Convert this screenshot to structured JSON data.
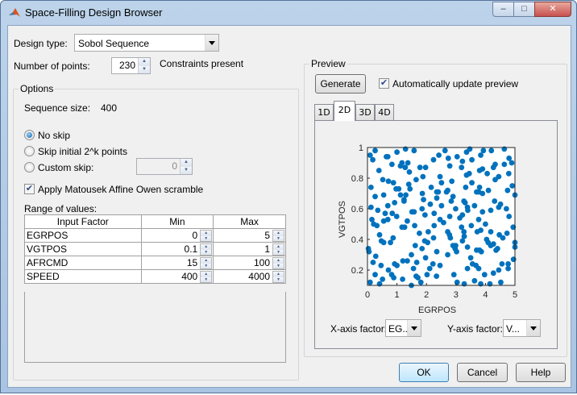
{
  "window": {
    "title": "Space-Filling Design Browser",
    "minimize": "–",
    "maximize": "□",
    "close": "✕"
  },
  "design_type": {
    "label": "Design type:",
    "value": "Sobol Sequence"
  },
  "num_points": {
    "label": "Number of points:",
    "value": "230",
    "note": "Constraints present"
  },
  "options": {
    "title": "Options",
    "sequence_size_label": "Sequence size:",
    "sequence_size": "400",
    "skip": [
      {
        "label": "No skip",
        "selected": true
      },
      {
        "label": "Skip initial 2^k points",
        "selected": false
      },
      {
        "label": "Custom skip:",
        "selected": false
      }
    ],
    "custom_skip_value": "0",
    "scramble": {
      "label": "Apply Matousek Affine Owen scramble",
      "checked": true
    },
    "range_label": "Range of values:",
    "table": {
      "headers": [
        "Input Factor",
        "Min",
        "Max"
      ],
      "rows": [
        [
          "EGRPOS",
          "0",
          "5"
        ],
        [
          "VGTPOS",
          "0.1",
          "1"
        ],
        [
          "AFRCMD",
          "15",
          "100"
        ],
        [
          "SPEED",
          "400",
          "4000"
        ]
      ]
    }
  },
  "preview": {
    "title": "Preview",
    "generate": "Generate",
    "auto_update": {
      "label": "Automatically update preview",
      "checked": true
    },
    "tabs": [
      "1D",
      "2D",
      "3D",
      "4D"
    ],
    "active_tab": "2D",
    "x_factor_label": "X-axis factor:",
    "x_factor_value": "EG...",
    "y_factor_label": "Y-axis factor:",
    "y_factor_value": "V..."
  },
  "buttons": {
    "ok": "OK",
    "cancel": "Cancel",
    "help": "Help"
  },
  "chart_data": {
    "type": "scatter",
    "xlabel": "EGRPOS",
    "ylabel": "VGTPOS",
    "xlim": [
      0,
      5
    ],
    "ylim": [
      0.1,
      1
    ],
    "xticks": [
      "0",
      "1",
      "2",
      "3",
      "4",
      "5"
    ],
    "yticks": [
      "0.2",
      "0.4",
      "0.6",
      "0.8",
      "1"
    ],
    "color": "#0072bd",
    "points": [
      [
        0.09,
        0.95
      ],
      [
        0.26,
        0.98
      ],
      [
        0.18,
        0.92
      ],
      [
        0.69,
        0.94
      ],
      [
        0.64,
        0.94
      ],
      [
        1.0,
        0.97
      ],
      [
        1.29,
        0.99
      ],
      [
        1.58,
        0.98
      ],
      [
        0.83,
        0.89
      ],
      [
        1.17,
        0.9
      ],
      [
        1.12,
        0.88
      ],
      [
        1.37,
        0.9
      ],
      [
        1.28,
        0.87
      ],
      [
        1.78,
        0.87
      ],
      [
        1.97,
        0.87
      ],
      [
        2.24,
        0.92
      ],
      [
        2.42,
        0.95
      ],
      [
        2.63,
        0.98
      ],
      [
        2.74,
        0.93
      ],
      [
        3.04,
        0.94
      ],
      [
        3.22,
        0.91
      ],
      [
        3.19,
        0.87
      ],
      [
        3.36,
        0.97
      ],
      [
        3.47,
        0.99
      ],
      [
        3.54,
        0.92
      ],
      [
        3.84,
        0.95
      ],
      [
        3.93,
        0.98
      ],
      [
        4.2,
        0.98
      ],
      [
        4.33,
        0.89
      ],
      [
        4.27,
        0.87
      ],
      [
        4.64,
        0.99
      ],
      [
        4.8,
        0.93
      ],
      [
        4.89,
        0.9
      ],
      [
        4.64,
        0.89
      ],
      [
        3.8,
        0.85
      ],
      [
        3.9,
        0.86
      ],
      [
        0.39,
        0.85
      ],
      [
        0.52,
        0.79
      ],
      [
        0.71,
        0.78
      ],
      [
        0.88,
        0.77
      ],
      [
        0.97,
        0.73
      ],
      [
        1.06,
        0.73
      ],
      [
        1.12,
        0.69
      ],
      [
        0.12,
        0.74
      ],
      [
        1.42,
        0.84
      ],
      [
        1.4,
        0.76
      ],
      [
        1.44,
        0.73
      ],
      [
        1.65,
        0.79
      ],
      [
        1.88,
        0.81
      ],
      [
        2.16,
        0.74
      ],
      [
        2.35,
        0.71
      ],
      [
        2.46,
        0.81
      ],
      [
        2.51,
        0.77
      ],
      [
        2.72,
        0.72
      ],
      [
        2.86,
        0.78
      ],
      [
        3.33,
        0.74
      ],
      [
        3.36,
        0.82
      ],
      [
        3.45,
        0.83
      ],
      [
        3.54,
        0.77
      ],
      [
        3.8,
        0.74
      ],
      [
        3.7,
        0.71
      ],
      [
        4.06,
        0.83
      ],
      [
        4.1,
        0.72
      ],
      [
        4.33,
        0.79
      ],
      [
        4.45,
        0.81
      ],
      [
        4.79,
        0.83
      ],
      [
        4.91,
        0.75
      ],
      [
        4.75,
        0.72
      ],
      [
        2.79,
        0.88
      ],
      [
        0.26,
        0.68
      ],
      [
        0.55,
        0.69
      ],
      [
        0.92,
        0.64
      ],
      [
        0.69,
        0.62
      ],
      [
        0.12,
        0.61
      ],
      [
        0.35,
        0.59
      ],
      [
        0.6,
        0.57
      ],
      [
        0.84,
        0.57
      ],
      [
        0.99,
        0.55
      ],
      [
        0.15,
        0.53
      ],
      [
        1.24,
        0.66
      ],
      [
        1.3,
        0.69
      ],
      [
        1.24,
        0.65
      ],
      [
        1.51,
        0.58
      ],
      [
        1.58,
        0.58
      ],
      [
        1.86,
        0.7
      ],
      [
        1.9,
        0.66
      ],
      [
        1.85,
        0.6
      ],
      [
        1.95,
        0.56
      ],
      [
        2.13,
        0.63
      ],
      [
        2.26,
        0.57
      ],
      [
        2.4,
        0.71
      ],
      [
        2.35,
        0.67
      ],
      [
        2.51,
        0.62
      ],
      [
        2.68,
        0.71
      ],
      [
        2.9,
        0.68
      ],
      [
        2.84,
        0.65
      ],
      [
        2.99,
        0.6
      ],
      [
        2.79,
        0.55
      ],
      [
        3.27,
        0.65
      ],
      [
        3.31,
        0.64
      ],
      [
        3.39,
        0.61
      ],
      [
        3.4,
        0.59
      ],
      [
        3.63,
        0.62
      ],
      [
        3.77,
        0.71
      ],
      [
        3.9,
        0.7
      ],
      [
        3.9,
        0.58
      ],
      [
        3.77,
        0.53
      ],
      [
        4.18,
        0.59
      ],
      [
        4.31,
        0.65
      ],
      [
        4.45,
        0.61
      ],
      [
        4.51,
        0.63
      ],
      [
        4.71,
        0.6
      ],
      [
        4.8,
        0.55
      ],
      [
        5.0,
        0.69
      ],
      [
        3.13,
        0.54
      ],
      [
        3.22,
        0.56
      ],
      [
        0.21,
        0.5
      ],
      [
        0.32,
        0.49
      ],
      [
        0.55,
        0.52
      ],
      [
        0.69,
        0.53
      ],
      [
        0.41,
        0.43
      ],
      [
        0.47,
        0.39
      ],
      [
        0.55,
        0.38
      ],
      [
        0.78,
        0.38
      ],
      [
        0.87,
        0.41
      ],
      [
        1.17,
        0.48
      ],
      [
        1.26,
        0.48
      ],
      [
        1.35,
        0.52
      ],
      [
        1.6,
        0.49
      ],
      [
        1.76,
        0.44
      ],
      [
        2.06,
        0.45
      ],
      [
        2.24,
        0.41
      ],
      [
        1.94,
        0.39
      ],
      [
        2.04,
        0.38
      ],
      [
        2.26,
        0.49
      ],
      [
        2.46,
        0.53
      ],
      [
        2.58,
        0.51
      ],
      [
        2.72,
        0.45
      ],
      [
        2.78,
        0.43
      ],
      [
        2.81,
        0.41
      ],
      [
        3.19,
        0.48
      ],
      [
        3.27,
        0.45
      ],
      [
        3.28,
        0.42
      ],
      [
        3.22,
        0.39
      ],
      [
        3.52,
        0.49
      ],
      [
        3.72,
        0.45
      ],
      [
        3.84,
        0.46
      ],
      [
        4.0,
        0.5
      ],
      [
        4.18,
        0.45
      ],
      [
        4.04,
        0.4
      ],
      [
        4.27,
        0.37
      ],
      [
        4.47,
        0.43
      ],
      [
        4.59,
        0.41
      ],
      [
        4.73,
        0.44
      ],
      [
        4.94,
        0.48
      ],
      [
        5.0,
        0.38
      ],
      [
        2.99,
        0.36
      ],
      [
        0.03,
        0.34
      ],
      [
        0.05,
        0.32
      ],
      [
        0.28,
        0.29
      ],
      [
        0.19,
        0.25
      ],
      [
        0.46,
        0.23
      ],
      [
        0.26,
        0.17
      ],
      [
        0.51,
        0.14
      ],
      [
        0.09,
        0.12
      ],
      [
        0.41,
        0.11
      ],
      [
        0.71,
        0.2
      ],
      [
        0.82,
        0.17
      ],
      [
        0.89,
        0.15
      ],
      [
        0.92,
        0.24
      ],
      [
        1.0,
        0.23
      ],
      [
        1.2,
        0.26
      ],
      [
        1.35,
        0.26
      ],
      [
        1.19,
        0.14
      ],
      [
        1.49,
        0.3
      ],
      [
        1.62,
        0.36
      ],
      [
        1.67,
        0.25
      ],
      [
        1.56,
        0.21
      ],
      [
        1.65,
        0.16
      ],
      [
        1.71,
        0.15
      ],
      [
        1.81,
        0.12
      ],
      [
        1.49,
        0.1
      ],
      [
        1.85,
        0.34
      ],
      [
        1.97,
        0.28
      ],
      [
        2.11,
        0.21
      ],
      [
        2.02,
        0.17
      ],
      [
        2.22,
        0.24
      ],
      [
        2.34,
        0.16
      ],
      [
        2.35,
        0.32
      ],
      [
        2.46,
        0.23
      ],
      [
        2.72,
        0.3
      ],
      [
        2.9,
        0.36
      ],
      [
        2.97,
        0.34
      ],
      [
        3.02,
        0.32
      ],
      [
        2.93,
        0.17
      ],
      [
        3.04,
        0.12
      ],
      [
        3.28,
        0.11
      ],
      [
        3.39,
        0.35
      ],
      [
        3.5,
        0.28
      ],
      [
        3.56,
        0.24
      ],
      [
        3.68,
        0.23
      ],
      [
        3.77,
        0.21
      ],
      [
        3.7,
        0.33
      ],
      [
        3.8,
        0.33
      ],
      [
        3.39,
        0.21
      ],
      [
        3.63,
        0.13
      ],
      [
        3.84,
        0.11
      ],
      [
        3.97,
        0.17
      ],
      [
        4.15,
        0.11
      ],
      [
        4.18,
        0.36
      ],
      [
        4.36,
        0.33
      ],
      [
        4.41,
        0.34
      ],
      [
        4.27,
        0.18
      ],
      [
        4.45,
        0.2
      ],
      [
        4.52,
        0.12
      ],
      [
        4.56,
        0.24
      ],
      [
        4.77,
        0.21
      ],
      [
        4.77,
        0.24
      ],
      [
        4.95,
        0.27
      ],
      [
        5.0,
        0.35
      ],
      [
        3.86,
        0.32
      ],
      [
        4.09,
        0.38
      ]
    ]
  }
}
